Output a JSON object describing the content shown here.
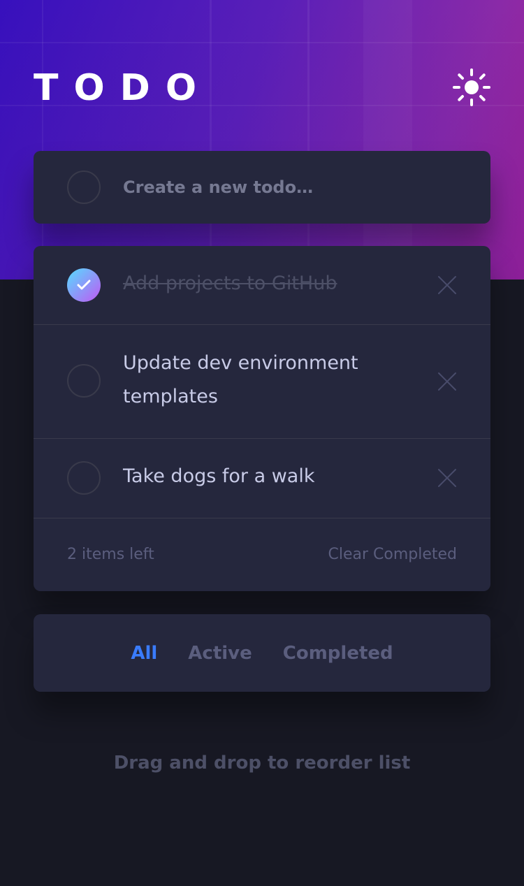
{
  "app": {
    "title": "TODO",
    "theme_toggle_icon": "sun-icon"
  },
  "new_todo": {
    "placeholder": "Create a new todo…"
  },
  "todos": [
    {
      "text": "Add projects to GitHub",
      "completed": true
    },
    {
      "text": "Update dev environment templates",
      "completed": false
    },
    {
      "text": "Take dogs for a walk",
      "completed": false
    }
  ],
  "footer": {
    "items_left": "2 items left",
    "clear_completed": "Clear Completed"
  },
  "filters": {
    "all": "All",
    "active": "Active",
    "completed": "Completed",
    "selected": "All"
  },
  "hint": "Drag and drop to reorder list",
  "colors": {
    "accent": "#3a7cfd",
    "check_gradient_start": "#55ddff",
    "check_gradient_end": "#c058f3",
    "card": "#25273d",
    "background": "#171823"
  }
}
